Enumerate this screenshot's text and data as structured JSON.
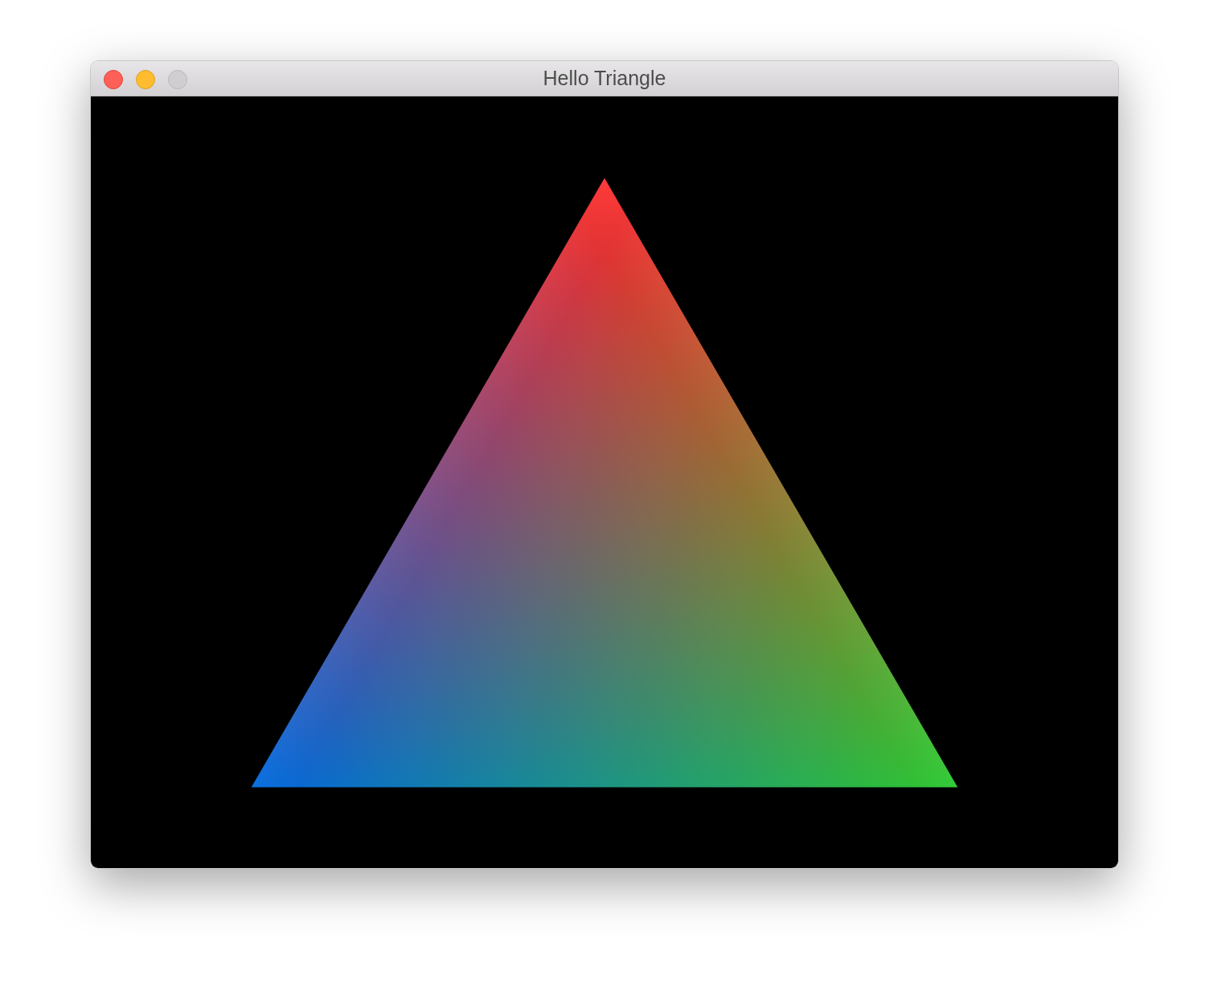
{
  "window": {
    "title": "Hello Triangle",
    "zoom_disabled": true
  }
}
